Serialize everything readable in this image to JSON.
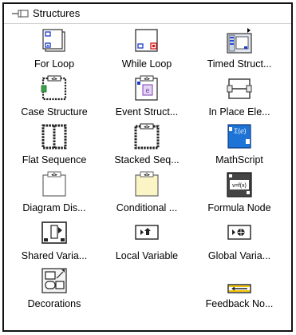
{
  "palette": {
    "title": "Structures",
    "items": [
      {
        "label": "For Loop",
        "icon": "for-loop-icon"
      },
      {
        "label": "While Loop",
        "icon": "while-loop-icon"
      },
      {
        "label": "Timed Struct...",
        "icon": "timed-structure-icon"
      },
      {
        "label": "Case Structure",
        "icon": "case-structure-icon"
      },
      {
        "label": "Event Struct...",
        "icon": "event-structure-icon"
      },
      {
        "label": "In Place Ele...",
        "icon": "in-place-element-icon"
      },
      {
        "label": "Flat Sequence",
        "icon": "flat-sequence-icon"
      },
      {
        "label": "Stacked Seq...",
        "icon": "stacked-sequence-icon"
      },
      {
        "label": "MathScript",
        "icon": "mathscript-icon"
      },
      {
        "label": "Diagram Dis...",
        "icon": "diagram-disable-icon"
      },
      {
        "label": "Conditional ...",
        "icon": "conditional-disable-icon"
      },
      {
        "label": "Formula Node",
        "icon": "formula-node-icon"
      },
      {
        "label": "Shared Varia...",
        "icon": "shared-variable-icon"
      },
      {
        "label": "Local Variable",
        "icon": "local-variable-icon"
      },
      {
        "label": "Global Varia...",
        "icon": "global-variable-icon"
      },
      {
        "label": "Decorations",
        "icon": "decorations-icon"
      },
      {
        "label": "",
        "icon": ""
      },
      {
        "label": "Feedback No...",
        "icon": "feedback-node-icon"
      }
    ],
    "glyphs": {
      "case_selector": "◂0▸",
      "event_selector": "◂0▸",
      "event_e": "e",
      "mathscript": "Ʃ(ⅇ)",
      "formula": "v=f(x)",
      "local_arrow": "▸⇑",
      "global_globe": "▸⊕"
    }
  }
}
